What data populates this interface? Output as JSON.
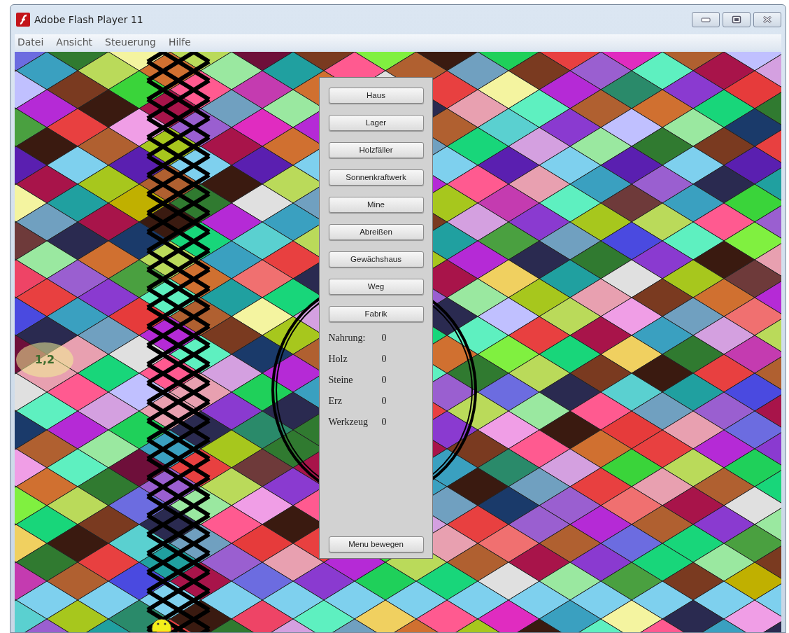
{
  "window": {
    "title": "Adobe Flash Player 11"
  },
  "menu": [
    "Datei",
    "Ansicht",
    "Steuerung",
    "Hilfe"
  ],
  "coordinate_badge": "1,2",
  "panel": {
    "buttons": [
      "Haus",
      "Lager",
      "Holzfäller",
      "Sonnenkraftwerk",
      "Mine",
      "Abreißen",
      "Gewächshaus",
      "Weg",
      "Fabrik"
    ],
    "resources": [
      {
        "label": "Nahrung:",
        "value": "0"
      },
      {
        "label": "Holz",
        "value": "0"
      },
      {
        "label": "Steine",
        "value": "0"
      },
      {
        "label": "Erz",
        "value": "0"
      },
      {
        "label": "Werkzeug",
        "value": "0"
      }
    ],
    "move_button": "Menu bewegen"
  }
}
